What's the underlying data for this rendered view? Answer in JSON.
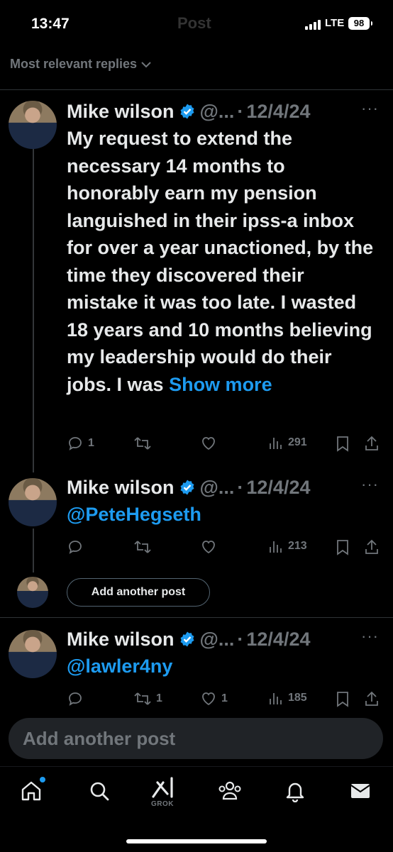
{
  "status": {
    "time": "13:47",
    "network": "LTE",
    "battery": "98"
  },
  "header": {
    "title": "Post"
  },
  "filter": {
    "label": "Most relevant replies"
  },
  "posts": [
    {
      "name": "Mike wilson",
      "handle": "@...",
      "date": "12/4/24",
      "text": "My request to extend the necessary 14 months to honorably earn my pension languished in their ipss-a inbox for over a year unactioned, by the time they discovered their mistake it was too late.  I wasted 18 years and 10 months believing my leadership would do their jobs. I was",
      "show_more": "Show more",
      "replies": "1",
      "reposts": "",
      "likes": "",
      "views": "291"
    },
    {
      "name": "Mike wilson",
      "handle": "@...",
      "date": "12/4/24",
      "mention": "@PeteHegseth",
      "replies": "",
      "reposts": "",
      "likes": "",
      "views": "213"
    },
    {
      "name": "Mike wilson",
      "handle": "@...",
      "date": "12/4/24",
      "mention": "@lawler4ny",
      "replies": "",
      "reposts": "1",
      "likes": "1",
      "views": "185"
    }
  ],
  "add_another_post": "Add another post",
  "composer": {
    "placeholder": "Add another post"
  },
  "tabbar": {
    "grok_label": "GROK"
  },
  "colors": {
    "accent": "#1d9bf0",
    "muted": "#71767b",
    "text": "#e7e9ea",
    "background": "#000000"
  },
  "icons": [
    "signal-icon",
    "battery-icon",
    "chevron-down-icon",
    "verified-badge-icon",
    "more-icon",
    "reply-icon",
    "repost-icon",
    "like-icon",
    "views-icon",
    "bookmark-icon",
    "share-icon",
    "home-icon",
    "search-icon",
    "grok-icon",
    "communities-icon",
    "notifications-icon",
    "messages-icon"
  ]
}
